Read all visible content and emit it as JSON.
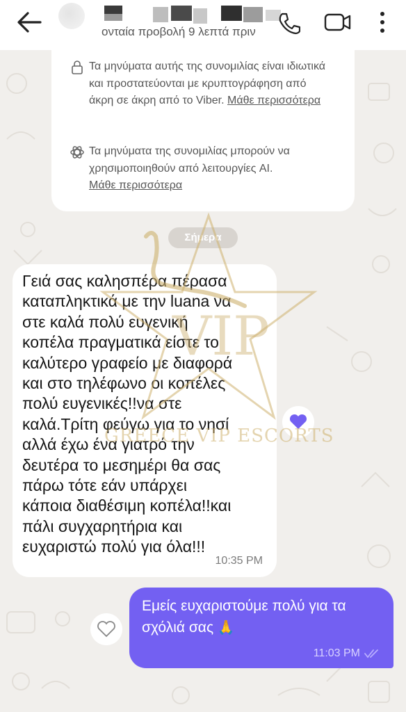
{
  "header": {
    "status": "ονταία προβολή 9 λεπτά πριν",
    "icons": {
      "back": "arrow-left-icon",
      "call": "phone-icon",
      "video": "video-camera-icon",
      "more": "more-vertical-icon"
    }
  },
  "info": {
    "encryption_text": "Τα μηνύματα αυτής της συνομιλίας είναι ιδιωτικά και προστατεύονται με κρυπτογράφηση από άκρη σε άκρη από το Viber.",
    "encryption_link": "Μάθε περισσότερα",
    "ai_text": "Τα μηνύματα της συνομιλίας μπορούν να χρησιμοποιηθούν από λειτουργίες AI.",
    "ai_link": "Μάθε περισσότερα"
  },
  "date_label": "Σήμερα",
  "messages": [
    {
      "direction": "incoming",
      "text": "Γειά σας καλησπέρα πέρασα\nκαταπληκτικά με την luana να\nστε καλά πολύ ευγενική\nκοπέλα πραγματικά είστε το\nκαλύτερο γραφείο με διαφορά\nκαι στο τηλέφωνο οι κοπέλες\nπολύ ευγενικές!!να στε\nκαλά.Τρίτη φεύγω για το νησί\nαλλά έχω ένα γιατρό την\nδευτέρα το μεσημέρι θα σας\nπάρω τότε εάν υπάρχει\nκάποια διαθέσιμη κοπέλα!!και\nπάλι συγχαρητήρια και\nευχαριστώ πολύ για όλα!!!",
      "time": "10:35 PM",
      "liked": true
    },
    {
      "direction": "outgoing",
      "text": "Εμείς ευχαριστούμε πολύ για τα σχόλιά σας",
      "emoji": "🙏",
      "time": "11:03 PM",
      "liked": false
    }
  ],
  "watermark": {
    "brand": "VIP",
    "text": "GREECE VIP ESCORTS"
  },
  "colors": {
    "accent": "#7360f2",
    "background": "#f1efec",
    "watermark": "#cdb06e"
  }
}
